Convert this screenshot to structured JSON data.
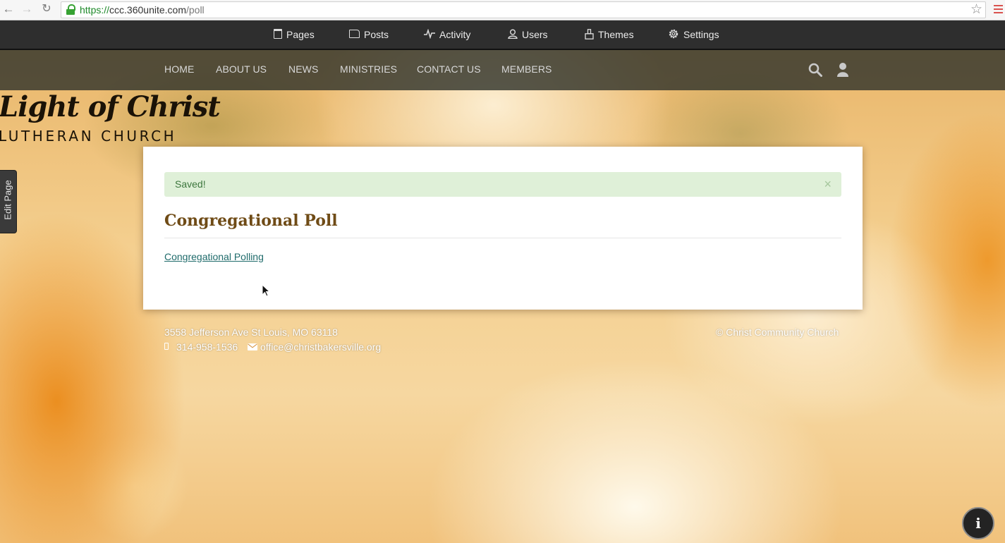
{
  "browser": {
    "url_scheme": "https://",
    "url_host": "ccc.360unite.com",
    "url_path": "/poll",
    "back_icon": "arrow-left-icon",
    "forward_icon": "arrow-right-icon",
    "reload_icon": "reload-icon",
    "lock_icon": "lock-icon",
    "bookmark_icon": "star-icon",
    "menu_icon": "hamburger-menu-icon"
  },
  "admin_bar": {
    "items": [
      {
        "label": "Pages",
        "icon": "page-icon"
      },
      {
        "label": "Posts",
        "icon": "folder-icon"
      },
      {
        "label": "Activity",
        "icon": "pulse-icon"
      },
      {
        "label": "Users",
        "icon": "user-icon"
      },
      {
        "label": "Themes",
        "icon": "brush-icon"
      },
      {
        "label": "Settings",
        "icon": "gear-icon"
      }
    ]
  },
  "site_nav": {
    "items": [
      "HOME",
      "ABOUT US",
      "NEWS",
      "MINISTRIES",
      "CONTACT US",
      "MEMBERS"
    ],
    "search_icon": "search-icon",
    "user_icon": "user-icon"
  },
  "logo": {
    "title": "Light of Christ",
    "subtitle": "LUTHERAN CHURCH"
  },
  "edit_tab": {
    "label": "Edit Page"
  },
  "main": {
    "alert_text": "Saved!",
    "alert_close": "×",
    "title": "Congregational Poll",
    "link_text": "Congregational Polling"
  },
  "footer": {
    "address": "3558 Jefferson Ave St Louis, MO 63118",
    "phone": "314-958-1536",
    "email": "office@christbakersville.org",
    "copyright": "© Christ Community Church",
    "phone_icon": "mobile-phone-icon",
    "email_icon": "envelope-icon"
  },
  "info_button": {
    "label": "i",
    "icon": "info-icon"
  },
  "colors": {
    "admin_bar": "#2e2e2e",
    "alert_bg": "#dff0d8",
    "alert_text": "#3c763d",
    "title": "#6f4b16",
    "link": "#1f6b6b"
  }
}
